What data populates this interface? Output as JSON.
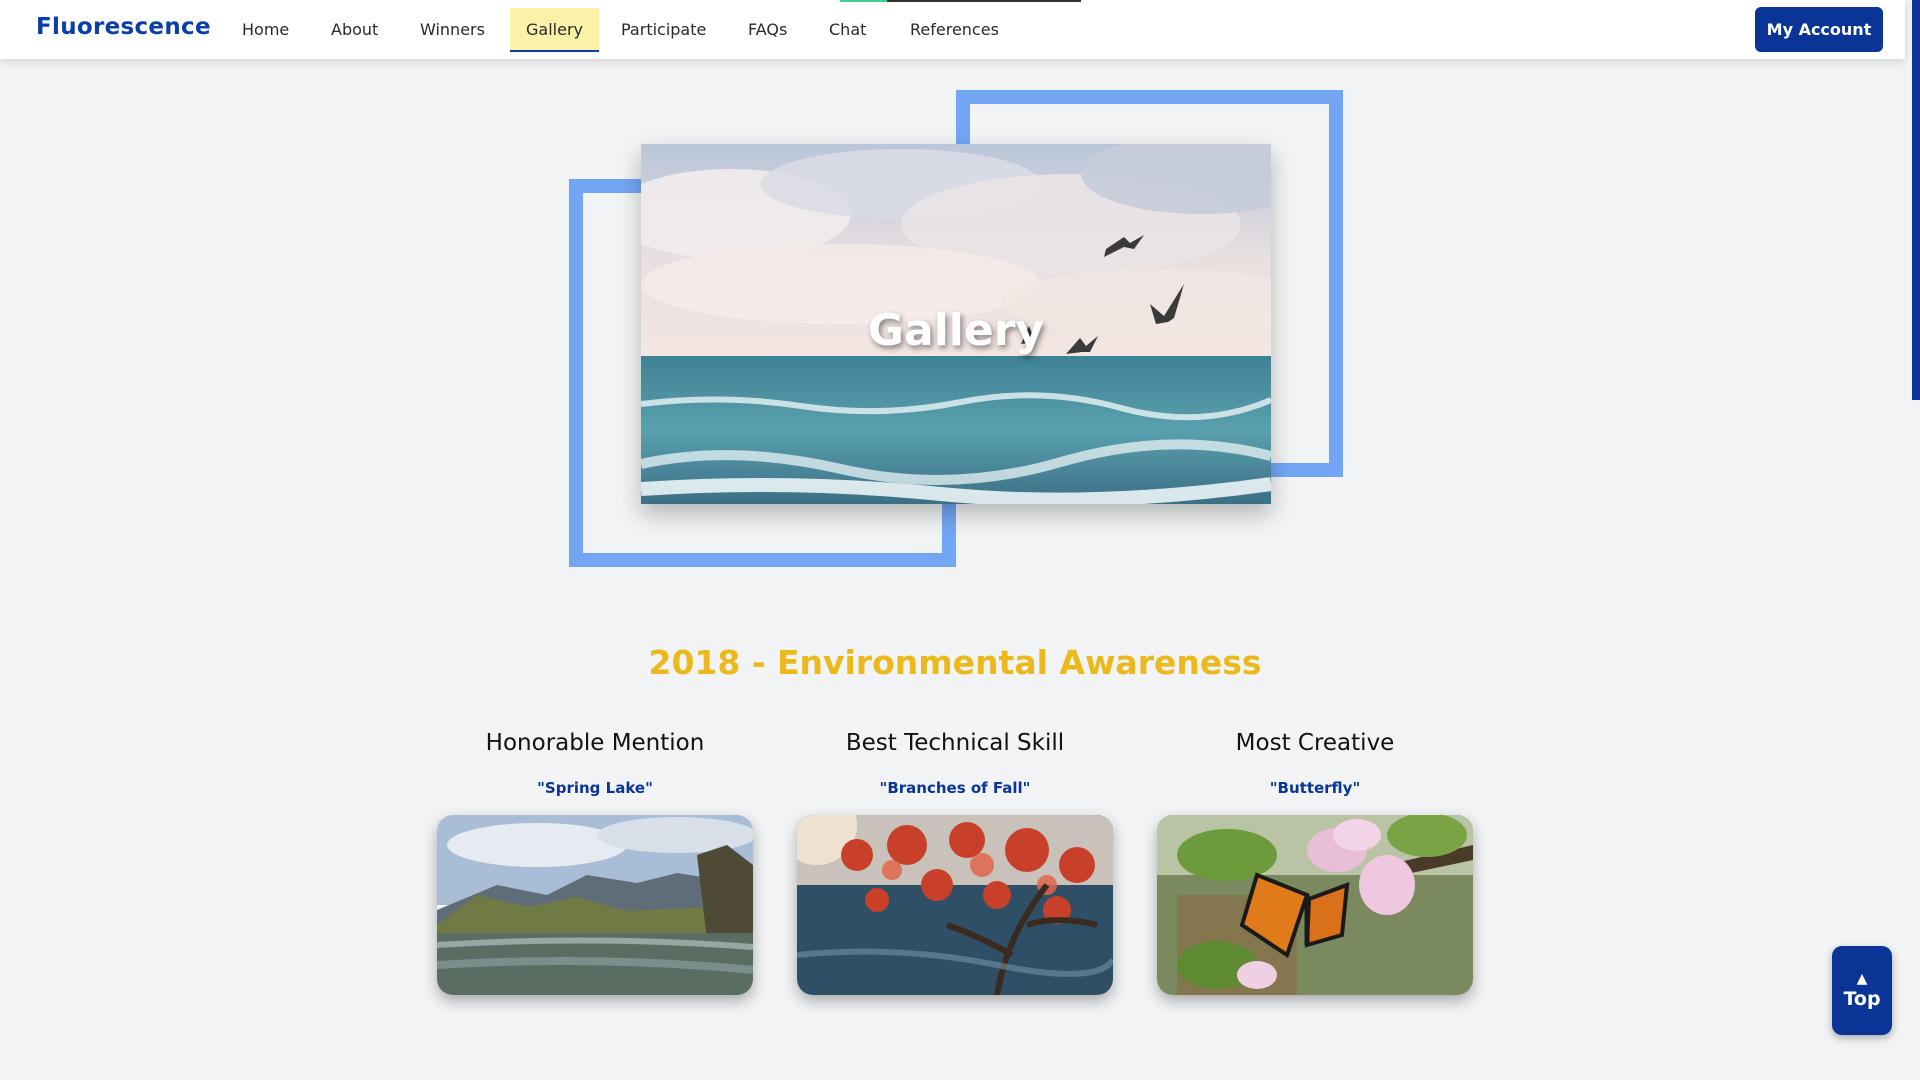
{
  "nav": {
    "brand": "Fluorescence",
    "items": [
      {
        "label": "Home"
      },
      {
        "label": "About"
      },
      {
        "label": "Winners"
      },
      {
        "label": "Gallery",
        "active": true
      },
      {
        "label": "Participate"
      },
      {
        "label": "FAQs"
      },
      {
        "label": "Chat"
      },
      {
        "label": "References"
      }
    ],
    "account_label": "My Account"
  },
  "hero": {
    "title": "Gallery"
  },
  "section": {
    "heading": "2018 - Environmental Awareness",
    "awards": [
      {
        "category": "Honorable Mention",
        "caption": "\"Spring Lake\""
      },
      {
        "category": "Best Technical Skill",
        "caption": "\"Branches of Fall\""
      },
      {
        "category": "Most Creative",
        "caption": "\"Butterfly\""
      }
    ]
  },
  "back_to_top": {
    "icon": "chevron-up-icon",
    "label": "Top"
  },
  "colors": {
    "brand_blue": "#0a3597",
    "accent_yellow": "#ebb91c",
    "frame_blue": "#72a6f5",
    "active_tab_bg": "#fbf1a9"
  }
}
